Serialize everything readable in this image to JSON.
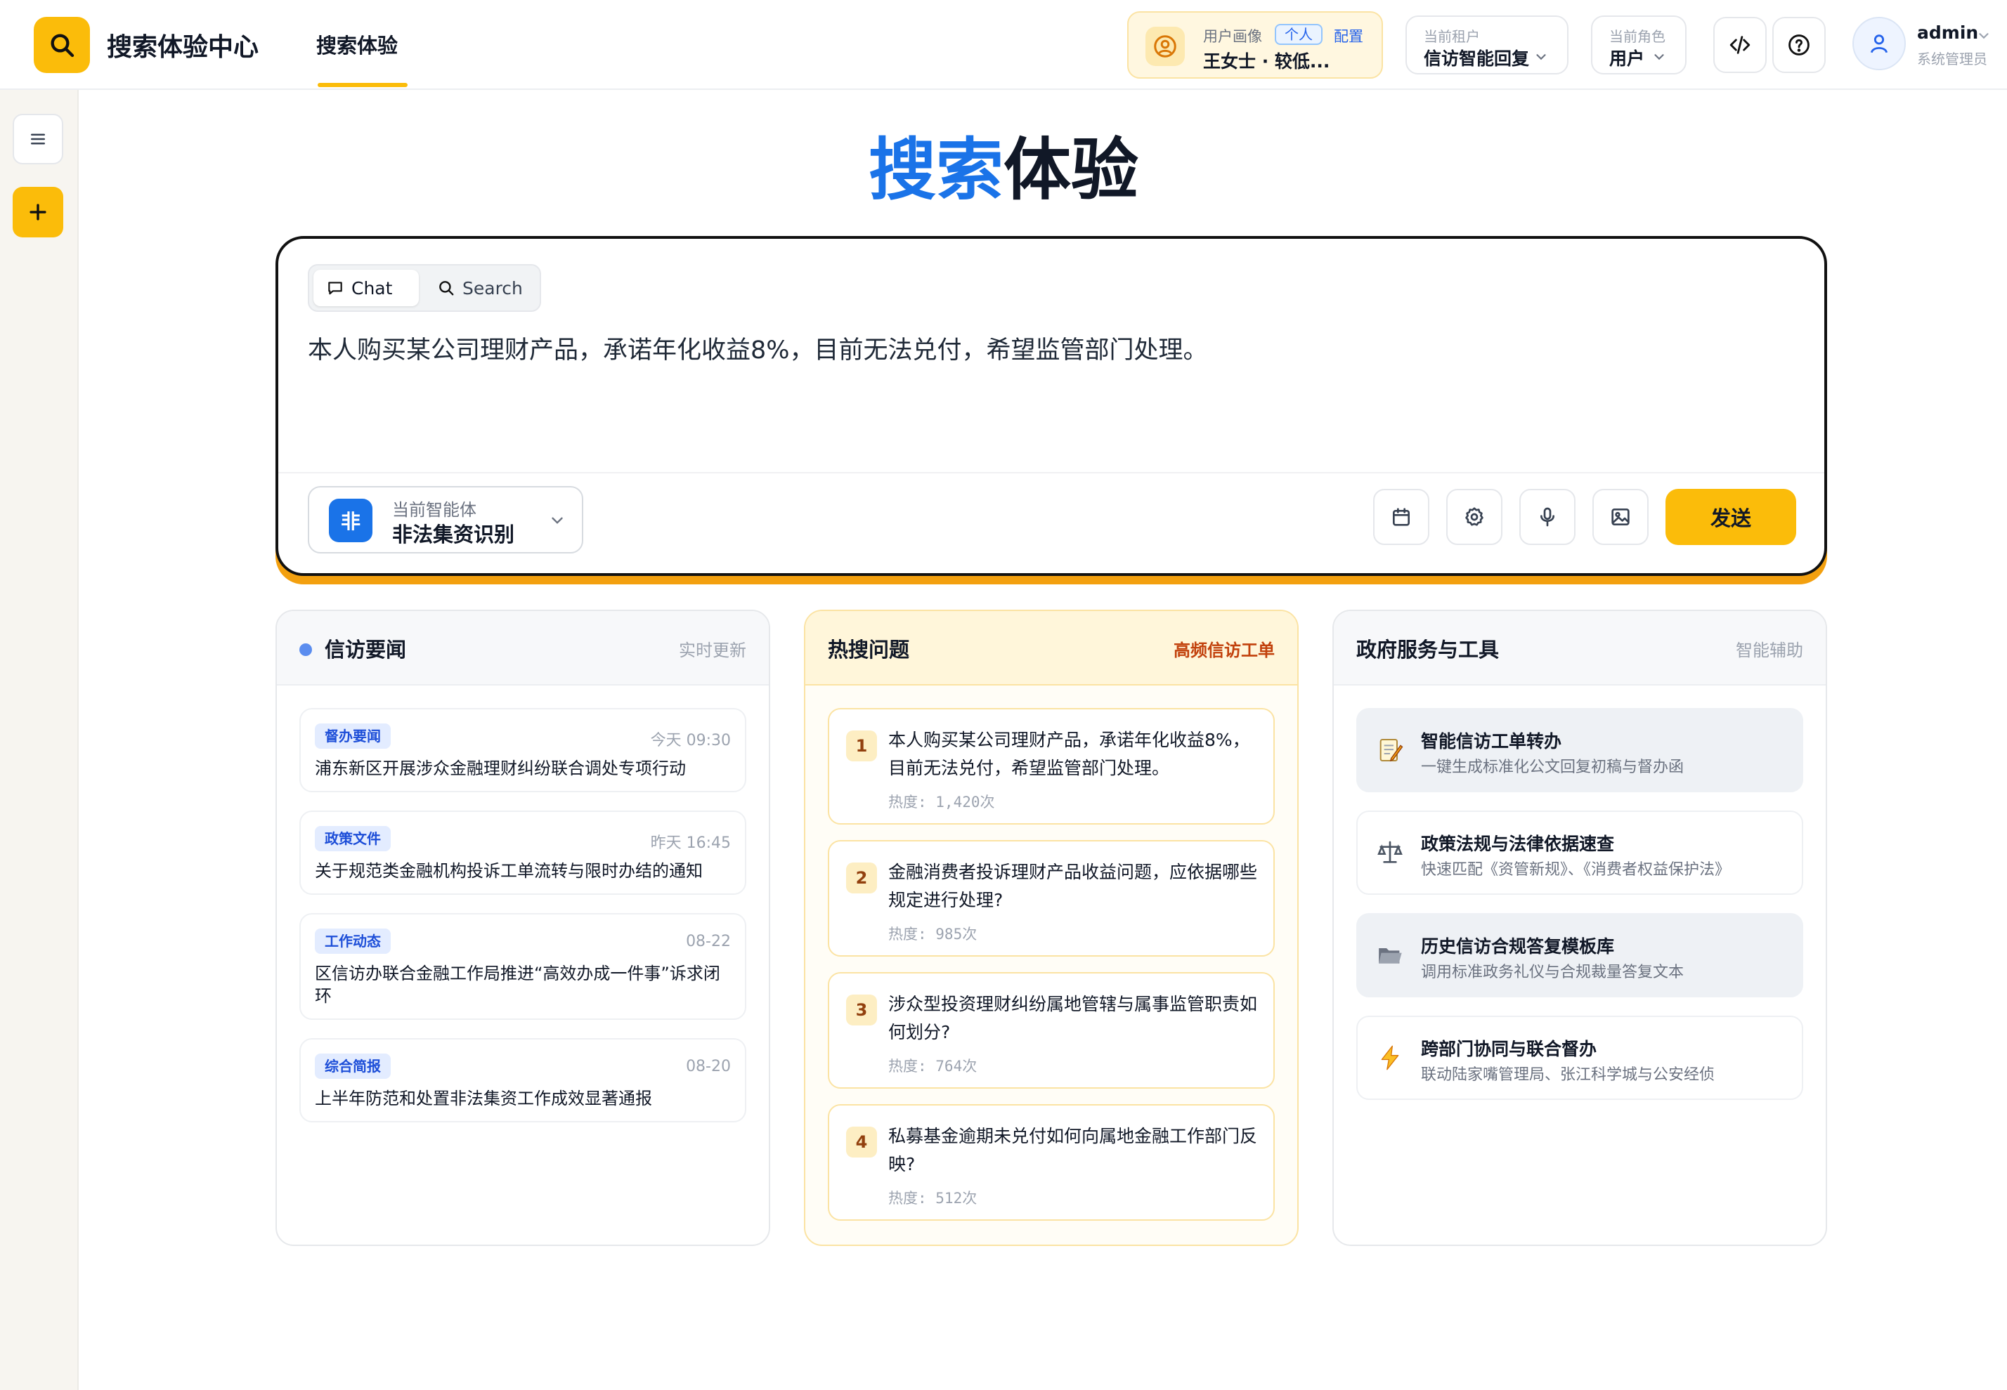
{
  "header": {
    "app_title": "搜索体验中心",
    "nav_tab": "搜索体验",
    "profile": {
      "label": "用户画像",
      "badge": "个人",
      "config": "配置",
      "name": "王女士 · 较低..."
    },
    "tenant": {
      "label": "当前租户",
      "value": "信访智能回复"
    },
    "role": {
      "label": "当前角色",
      "value": "用户"
    },
    "user": {
      "name": "admin",
      "role": "系统管理员"
    }
  },
  "hero": {
    "title_blue": "搜索",
    "title_dark": "体验"
  },
  "search": {
    "mode_chat": "Chat",
    "mode_search": "Search",
    "query": "本人购买某公司理财产品，承诺年化收益8%，目前无法兑付，希望监管部门处理。",
    "agent_label": "当前智能体",
    "agent_avatar": "非",
    "agent_name": "非法集资识别",
    "send": "发送"
  },
  "news": {
    "title": "信访要闻",
    "tag": "实时更新",
    "items": [
      {
        "category": "督办要闻",
        "time": "今天 09:30",
        "title": "浦东新区开展涉众金融理财纠纷联合调处专项行动"
      },
      {
        "category": "政策文件",
        "time": "昨天 16:45",
        "title": "关于规范类金融机构投诉工单流转与限时办结的通知"
      },
      {
        "category": "工作动态",
        "time": "08-22",
        "title": "区信访办联合金融工作局推进“高效办成一件事”诉求闭环"
      },
      {
        "category": "综合简报",
        "time": "08-20",
        "title": "上半年防范和处置非法集资工作成效显著通报"
      }
    ]
  },
  "hot": {
    "title": "热搜问题",
    "tag": "高频信访工单",
    "items": [
      {
        "rank": "1",
        "text": "本人购买某公司理财产品，承诺年化收益8%，目前无法兑付，希望监管部门处理。",
        "count": "热度: 1,420次"
      },
      {
        "rank": "2",
        "text": "金融消费者投诉理财产品收益问题，应依据哪些规定进行处理?",
        "count": "热度: 985次"
      },
      {
        "rank": "3",
        "text": "涉众型投资理财纠纷属地管辖与属事监管职责如何划分?",
        "count": "热度: 764次"
      },
      {
        "rank": "4",
        "text": "私募基金逾期未兑付如何向属地金融工作部门反映?",
        "count": "热度: 512次"
      }
    ]
  },
  "tools": {
    "title": "政府服务与工具",
    "tag": "智能辅助",
    "items": [
      {
        "icon": "memo-icon",
        "name": "智能信访工单转办",
        "desc": "一键生成标准化公文回复初稿与督办函"
      },
      {
        "icon": "scales-icon",
        "name": "政策法规与法律依据速查",
        "desc": "快速匹配《资管新规》、《消费者权益保护法》"
      },
      {
        "icon": "folder-icon",
        "name": "历史信访合规答复模板库",
        "desc": "调用标准政务礼仪与合规裁量答复文本"
      },
      {
        "icon": "lightning-icon",
        "name": "跨部门协同与联合督办",
        "desc": "联动陆家嘴管理局、张江科学城与公安经侦"
      }
    ]
  },
  "colors": {
    "accent": "#fbbc0a",
    "brand_blue": "#1a73e8",
    "orange_shadow": "#f3a00f"
  }
}
